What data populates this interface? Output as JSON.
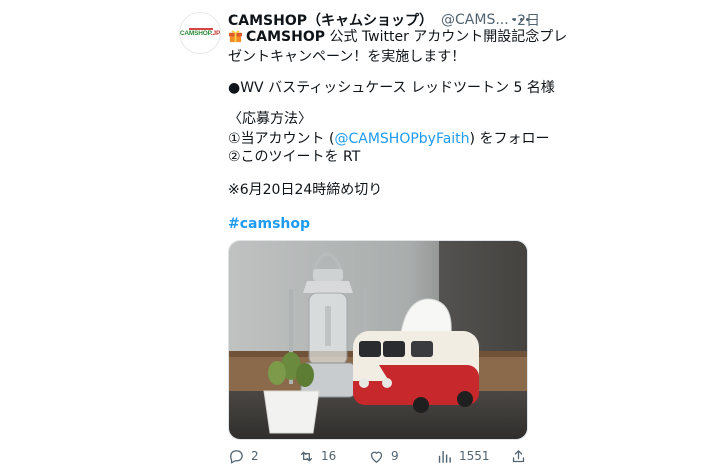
{
  "tweet": {
    "display_name": "CAMSHOP（キャムショップ）",
    "handle": "@CAMS...",
    "separator": "·",
    "time": "2日",
    "avatar_logo_text_brand": "CAMSHOP",
    "avatar_logo_text_suffix": ".JP",
    "body": {
      "line1_bold": "CAMSHOP",
      "line1_rest": " 公式 Twitter アカウント開設記念プレ",
      "line2": "ゼントキャンペーン！を実施します！",
      "line3": "●WV バスティッシュケース レッドツートン 5 名様",
      "line4": "〈応募方法〉",
      "line5_pre": "①当アカウント (",
      "line5_link": "@CAMSHOPbyFaith",
      "line5_post": ") をフォロー",
      "line6": "②このツイートを RT",
      "line7": "※6月20日24時締め切り",
      "hashtag": "#camshop"
    },
    "gift_icon": "wrapped-gift-emoji",
    "metrics": {
      "replies": "2",
      "retweets": "16",
      "likes": "9",
      "views": "1551"
    },
    "action_icons": [
      "reply-icon",
      "retweet-icon",
      "like-icon",
      "views-icon",
      "share-icon"
    ],
    "colors": {
      "link": "#1d9bf0",
      "text": "#0f1419",
      "secondary": "#536471"
    }
  }
}
